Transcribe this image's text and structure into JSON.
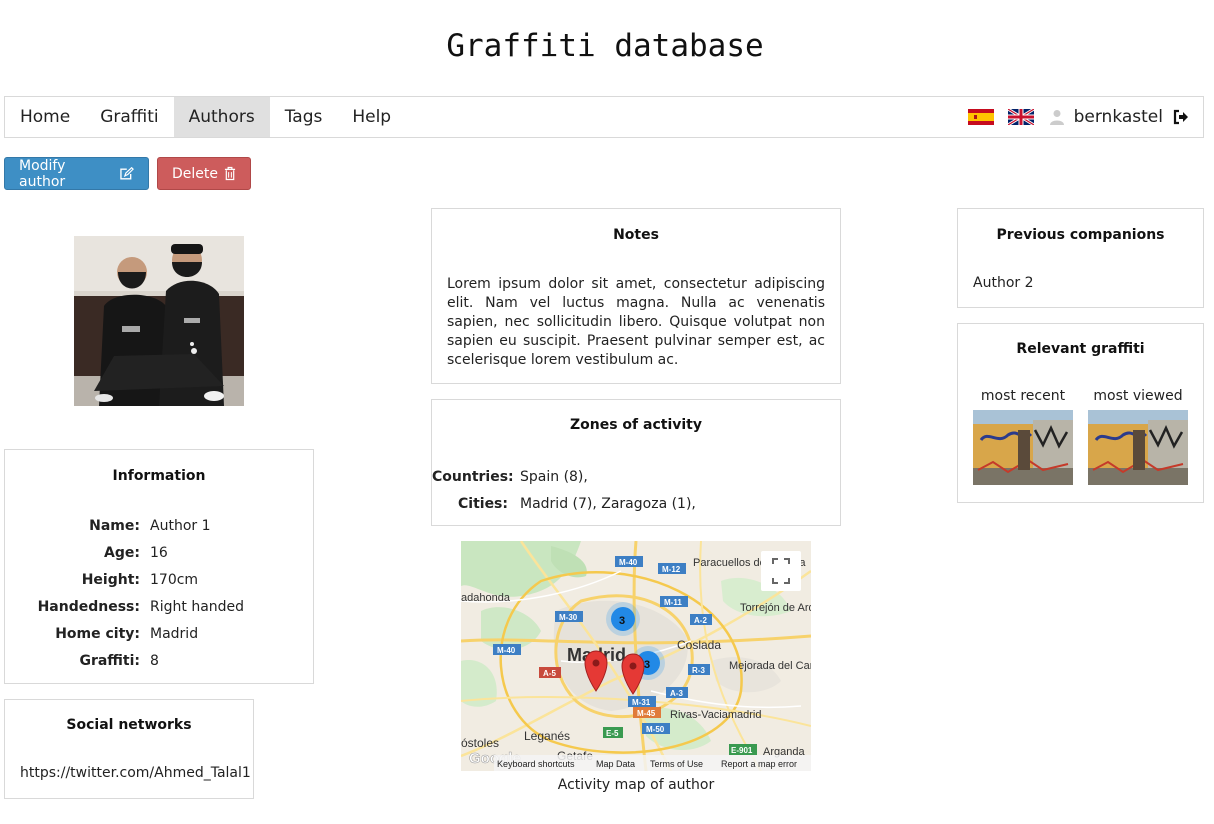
{
  "site": {
    "title": "Graffiti database"
  },
  "nav": {
    "items": [
      {
        "label": "Home"
      },
      {
        "label": "Graffiti"
      },
      {
        "label": "Authors",
        "active": true
      },
      {
        "label": "Tags"
      },
      {
        "label": "Help"
      }
    ],
    "username": "bernkastel",
    "icons": [
      "spain-flag-icon",
      "uk-flag-icon",
      "user-icon",
      "logout-icon"
    ]
  },
  "actions": {
    "modify_label": "Modify author",
    "delete_label": "Delete",
    "modify_color": "#3e8fc5",
    "delete_color": "#cd5c5c"
  },
  "information": {
    "title": "Information",
    "rows": [
      {
        "key": "Name:",
        "value": "Author 1"
      },
      {
        "key": "Age:",
        "value": "16"
      },
      {
        "key": "Height:",
        "value": "170cm"
      },
      {
        "key": "Handedness:",
        "value": "Right handed"
      },
      {
        "key": "Home city:",
        "value": "Madrid"
      },
      {
        "key": "Graffiti:",
        "value": "8"
      }
    ]
  },
  "social": {
    "title": "Social networks",
    "link": "https://twitter.com/Ahmed_Talal1"
  },
  "notes": {
    "title": "Notes",
    "text": "Lorem ipsum dolor sit amet, consectetur adipiscing elit. Nam vel luctus magna. Nulla ac venenatis sapien, nec sollicitudin libero. Quisque volutpat non sapien eu suscipit. Praesent pulvinar semper est, ac scelerisque lorem vestibulum ac."
  },
  "zones": {
    "title": "Zones of activity",
    "countries_label": "Countries:",
    "countries": "Spain (8),",
    "cities_label": "Cities:",
    "cities": "Madrid (7), Zaragoza (1),"
  },
  "map": {
    "caption": "Activity map of author",
    "labels": {
      "madrid": "Madrid",
      "coslada": "Coslada",
      "torrejon": "Torrejón de Ardoz",
      "paracuellos": "Paracuellos de Jarama",
      "alcobendas": "",
      "alcorcon": "",
      "leganes": "Leganés",
      "getafe": "Getafe",
      "mostoles": "óstoles",
      "mejorada": "Mejorada del Campo",
      "rivas": "Rivas-Vaciamadrid",
      "arganda": "Arganda",
      "adahonda": "adahonda"
    },
    "roads": [
      "M-40",
      "M-12",
      "M-11",
      "M-30",
      "M-40",
      "A-5",
      "A-2",
      "R-3",
      "A-3",
      "M-31",
      "M-45",
      "M-50",
      "E-5",
      "E-901",
      "M-30",
      "M-40"
    ],
    "clusters": [
      "3",
      "3"
    ],
    "footer": {
      "logo": "Google",
      "shortcuts": "Keyboard shortcuts",
      "map_data": "Map Data",
      "terms": "Terms of Use",
      "report": "Report a map error"
    }
  },
  "companions": {
    "title": "Previous companions",
    "items": [
      "Author 2"
    ]
  },
  "relevant": {
    "title": "Relevant graffiti",
    "most_recent": "most recent",
    "most_viewed": "most viewed"
  }
}
